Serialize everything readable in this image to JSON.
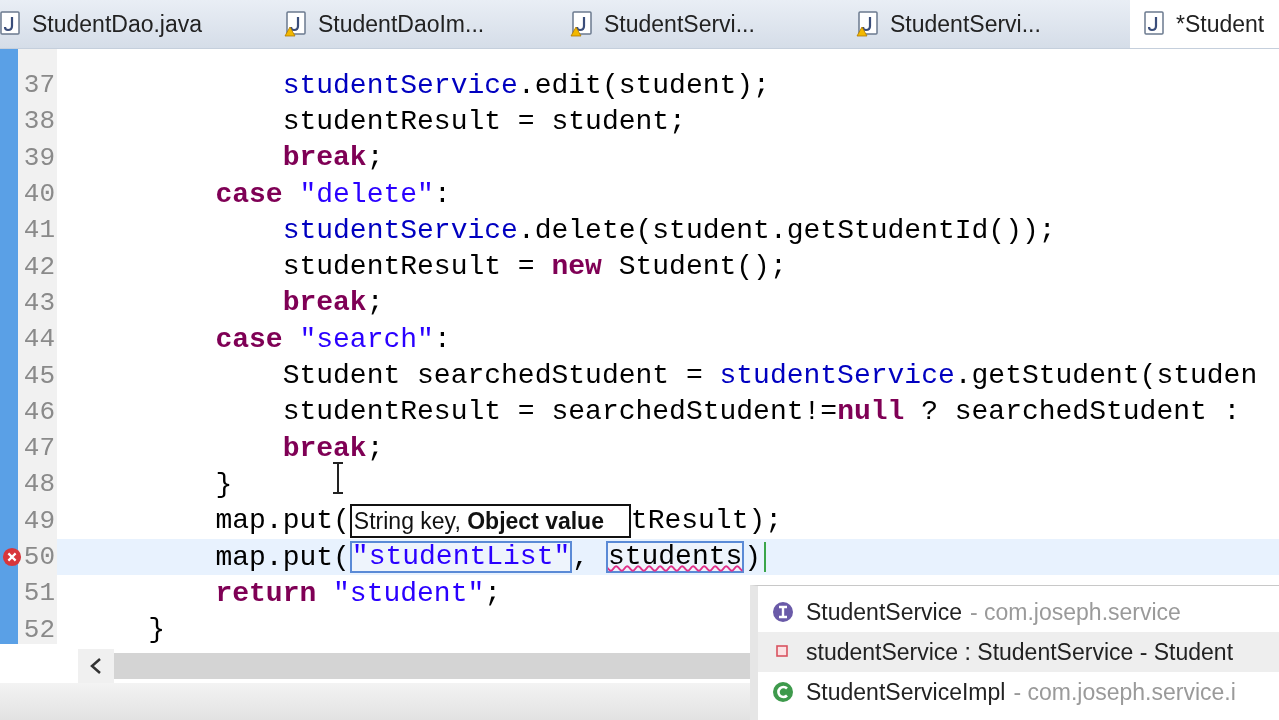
{
  "tabs": [
    {
      "label": "StudentDao.java",
      "warning": false,
      "selected": false
    },
    {
      "label": "StudentDaoIm...",
      "warning": true,
      "selected": false
    },
    {
      "label": "StudentServi...",
      "warning": true,
      "selected": false
    },
    {
      "label": "StudentServi...",
      "warning": true,
      "selected": false
    },
    {
      "label": "*Student",
      "warning": false,
      "selected": true
    }
  ],
  "editor": {
    "lines": [
      {
        "children": [
          {
            "children": [
              {
                "number": "37",
                "parts": [
                  {
                    "kind": "code",
                    "tokens": [
                      {
                        "kind": "field",
                        "text": "studentService"
                      },
                      {
                        "kind": "plain",
                        "text": ".edit(student);"
                      }
                    ]
                  }
                ]
              },
              {
                "number": "38",
                "parts": [
                  {
                    "kind": "code",
                    "tokens": [
                      {
                        "kind": "plain",
                        "text": "studentResult = student;"
                      }
                    ]
                  }
                ]
              },
              {
                "number": "39",
                "parts": [
                  {
                    "kind": "code",
                    "tokens": [
                      {
                        "kind": "keyword",
                        "text": "break"
                      },
                      {
                        "kind": "plain",
                        "text": ";"
                      }
                    ]
                  }
                ]
              }
            ]
          },
          {
            "number": "40",
            "parts": [
              {
                "kind": "code",
                "tokens": [
                  {
                    "kind": "keyword",
                    "text": "case"
                  },
                  {
                    "kind": "string",
                    "text": " \"delete\""
                  },
                  {
                    "kind": "plain",
                    "text": ":"
                  }
                ]
              }
            ]
          },
          {
            "children": [
              {
                "number": "41",
                "parts": [
                  {
                    "kind": "code",
                    "tokens": [
                      {
                        "kind": "field",
                        "text": "studentService"
                      },
                      {
                        "kind": "plain",
                        "text": ".delete(student.getStudentId());"
                      }
                    ]
                  }
                ]
              },
              {
                "number": "42",
                "parts": [
                  {
                    "kind": "code",
                    "tokens": [
                      {
                        "kind": "plain",
                        "text": "studentResult = "
                      },
                      {
                        "kind": "keyword",
                        "text": "new"
                      },
                      {
                        "kind": "plain",
                        "text": " Student();"
                      }
                    ]
                  }
                ]
              },
              {
                "number": "43",
                "parts": [
                  {
                    "kind": "code",
                    "tokens": [
                      {
                        "kind": "keyword",
                        "text": "break"
                      },
                      {
                        "kind": "plain",
                        "text": ";"
                      }
                    ]
                  }
                ]
              }
            ]
          },
          {
            "number": "44",
            "parts": [
              {
                "kind": "code",
                "tokens": [
                  {
                    "kind": "keyword",
                    "text": "case"
                  },
                  {
                    "kind": "string",
                    "text": " \"search\""
                  },
                  {
                    "kind": "plain",
                    "text": ":"
                  }
                ]
              }
            ]
          },
          {
            "children": [
              {
                "number": "45",
                "parts": [
                  {
                    "kind": "code",
                    "tokens": [
                      {
                        "kind": "plain",
                        "text": "Student searchedStudent = "
                      },
                      {
                        "kind": "field",
                        "text": "studentService"
                      },
                      {
                        "kind": "plain",
                        "text": ".getStudent(studen"
                      }
                    ]
                  }
                ]
              },
              {
                "number": "46",
                "parts": [
                  {
                    "kind": "code",
                    "tokens": [
                      {
                        "kind": "plain",
                        "text": "studentResult = searchedStudent!="
                      },
                      {
                        "kind": "keyword",
                        "text": "null"
                      },
                      {
                        "kind": "plain",
                        "text": " ? searchedStudent :"
                      }
                    ]
                  }
                ]
              },
              {
                "number": "47",
                "parts": [
                  {
                    "kind": "code",
                    "tokens": [
                      {
                        "kind": "keyword",
                        "text": "break"
                      },
                      {
                        "kind": "plain",
                        "text": ";"
                      }
                    ]
                  }
                ]
              }
            ]
          },
          {
            "number": "48",
            "parts": [
              {
                "kind": "code",
                "tokens": [
                  {
                    "kind": "plain",
                    "text": "}"
                  }
                ]
              }
            ]
          },
          {
            "number": "49",
            "parts": [
              {
                "kind": "code",
                "tokens": [
                  {
                    "kind": "plain",
                    "text": "map.put("
                  }
                ]
              },
              {
                "kind": "hint",
                "text": "String key, **Object value**"
              },
              {
                "kind": "code",
                "tokens": [
                  {
                    "kind": "plain",
                    "text": "tResult);"
                  }
                ]
              }
            ]
          },
          {
            "number": "50",
            "current": true,
            "error": true,
            "caret": true,
            "parts": [
              {
                "kind": "code",
                "tokens": [
                  {
                    "kind": "plain",
                    "text": "map.put("
                  }
                ]
              },
              {
                "kind": "linked",
                "error": false,
                "tokens": [
                  {
                    "kind": "string",
                    "text": "\"studentList\""
                  }
                ]
              },
              {
                "kind": "code",
                "tokens": [
                  {
                    "kind": "plain",
                    "text": ", "
                  }
                ]
              },
              {
                "kind": "linked",
                "error": true,
                "tokens": [
                  {
                    "kind": "plain",
                    "text": "students"
                  }
                ]
              },
              {
                "kind": "code",
                "tokens": [
                  {
                    "kind": "plain",
                    "text": ")"
                  }
                ]
              }
            ]
          },
          {
            "number": "51",
            "parts": [
              {
                "kind": "code",
                "tokens": [
                  {
                    "kind": "keyword",
                    "text": "return"
                  },
                  {
                    "kind": "string",
                    "text": " \"student\""
                  },
                  {
                    "kind": "plain",
                    "text": ";"
                  }
                ]
              }
            ]
          }
        ]
      },
      {
        "number": "52",
        "parts": [
          {
            "kind": "code",
            "tokens": [
              {
                "kind": "plain",
                "text": "}"
              }
            ]
          }
        ]
      }
    ]
  },
  "completion": {
    "items": [
      {
        "kind": "interface",
        "label": "StudentService",
        "detail": "- com.joseph.service",
        "selected": false
      },
      {
        "kind": "field",
        "label": "studentService : StudentService - Student",
        "selected": true
      },
      {
        "kind": "class",
        "label": "StudentServiceImpl",
        "detail": "- com.joseph.service.i",
        "selected": false
      }
    ]
  }
}
